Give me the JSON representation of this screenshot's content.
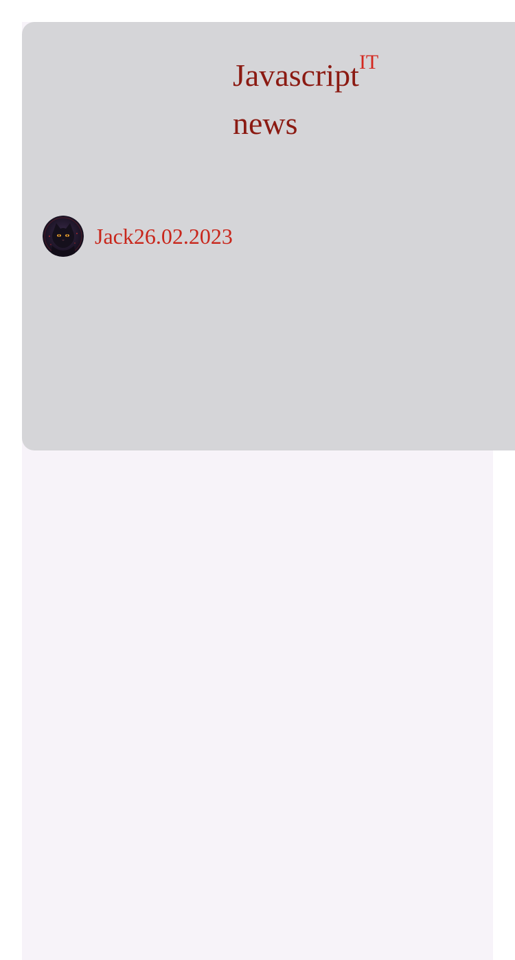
{
  "post": {
    "title_line1": "Javascript",
    "badge": "IT",
    "title_line2": "news",
    "author": "Jack",
    "date": "26.02.2023",
    "avatar_icon": "black-cat-avatar-icon"
  },
  "colors": {
    "card_background": "#d5d5d8",
    "page_background": "#f7f3f9",
    "title": "#8b1a12",
    "accent": "#c8261b"
  }
}
